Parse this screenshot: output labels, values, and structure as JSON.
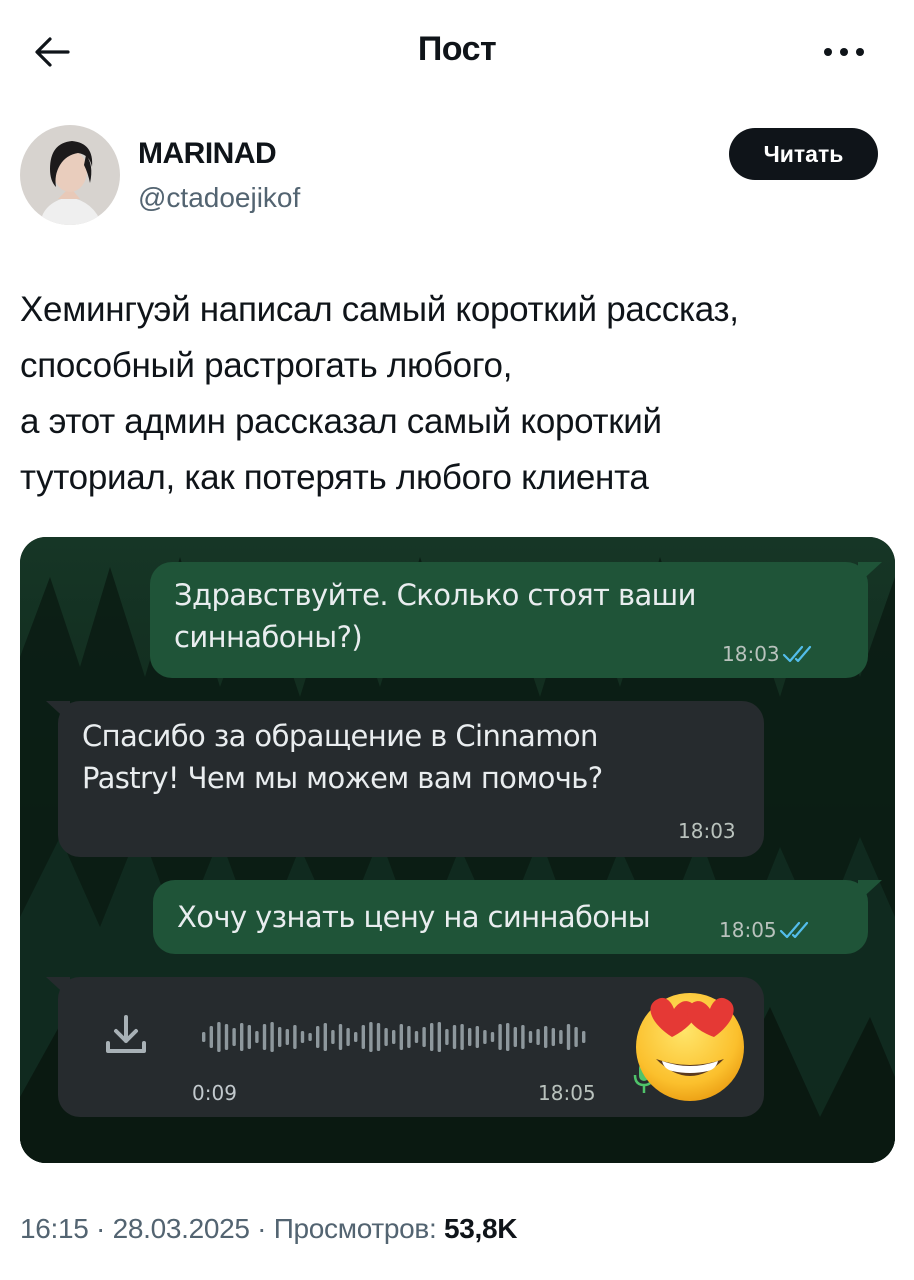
{
  "header": {
    "title": "Пост",
    "back_icon": "arrow-left-icon",
    "more_icon": "more-horizontal-icon"
  },
  "author": {
    "display_name": "MARINAD",
    "handle": "@ctadoejikof",
    "avatar_icon": "user-avatar",
    "follow_label": "Читать"
  },
  "tweet": {
    "lines": [
      "Хемингуэй написал самый короткий рассказ,",
      "способный растрогать любого,",
      "а этот админ рассказал самый короткий",
      "туториал, как потерять любого клиента"
    ]
  },
  "chat": {
    "messages": [
      {
        "direction": "outgoing",
        "lines": [
          "Здравствуйте. Сколько стоят ваши",
          "синнабоны?)"
        ],
        "time": "18:03",
        "read": true
      },
      {
        "direction": "incoming",
        "lines": [
          "Спасибо за обращение в Cinnamon",
          "Pastry! Чем мы можем вам помочь?"
        ],
        "time": "18:03"
      },
      {
        "direction": "outgoing",
        "lines": [
          "Хочу узнать цену на синнабоны"
        ],
        "time": "18:05",
        "read": true
      },
      {
        "direction": "incoming",
        "type": "voice",
        "duration": "0:09",
        "time": "18:05",
        "download_icon": "download-icon",
        "mic_icon": "microphone-icon",
        "reaction_icon": "heart-eyes-emoji-icon"
      }
    ],
    "colors": {
      "outgoing": "#1f5438",
      "incoming": "#262b2e",
      "read_ticks": "#53bdeb"
    }
  },
  "footer": {
    "time": "16:15",
    "separator": " · ",
    "date": "28.03.2025",
    "views_label": "Просмотров: ",
    "views_count": "53,8K"
  }
}
